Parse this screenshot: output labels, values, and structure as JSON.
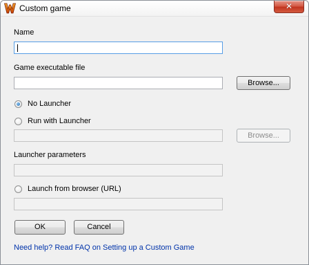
{
  "window": {
    "title": "Custom game",
    "close_label": "✕"
  },
  "form": {
    "name_label": "Name",
    "name_value": "",
    "exe_label": "Game executable file",
    "exe_value": "",
    "browse_label": "Browse...",
    "no_launcher_label": "No Launcher",
    "no_launcher_checked": true,
    "run_with_launcher_label": "Run with Launcher",
    "run_with_launcher_checked": false,
    "launcher_value": "",
    "launcher_browse_label": "Browse...",
    "launcher_params_label": "Launcher parameters",
    "launcher_params_value": "",
    "browser_label": "Launch from browser (URL)",
    "browser_checked": false,
    "browser_url_value": ""
  },
  "buttons": {
    "ok_label": "OK",
    "cancel_label": "Cancel"
  },
  "help": {
    "link_text": "Need help? Read FAQ on Setting up a Custom Game"
  },
  "colors": {
    "dialog_bg": "#f0f0f0",
    "link": "#0033aa",
    "close_button": "#c0331e",
    "radio_dot": "#1e6cb3"
  },
  "icons": {
    "app": "w-logo-icon",
    "close": "close-icon"
  }
}
